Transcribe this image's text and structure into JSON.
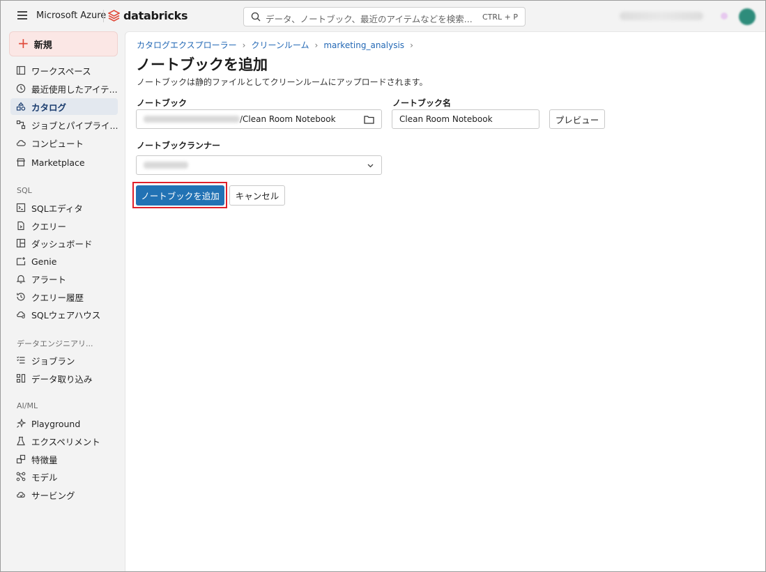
{
  "topbar": {
    "brand_ms": "Microsoft Azure",
    "brand_db": "databricks",
    "search_placeholder": "データ、ノートブック、最近のアイテムなどを検索...",
    "search_shortcut": "CTRL + P",
    "accent": "#e04a3a"
  },
  "sidebar": {
    "new_label": "新規",
    "items": [
      {
        "label": "ワークスペース",
        "icon": "workspace-icon"
      },
      {
        "label": "最近使用したアイテ...",
        "icon": "clock-icon"
      },
      {
        "label": "カタログ",
        "icon": "catalog-icon",
        "active": true
      },
      {
        "label": "ジョブとパイプライ...",
        "icon": "jobs-icon"
      },
      {
        "label": "コンピュート",
        "icon": "cloud-icon"
      },
      {
        "label": "Marketplace",
        "icon": "store-icon"
      }
    ],
    "sql_section": "SQL",
    "sql_items": [
      {
        "label": "SQLエディタ",
        "icon": "sql-editor-icon"
      },
      {
        "label": "クエリー",
        "icon": "query-icon"
      },
      {
        "label": "ダッシュボード",
        "icon": "dashboard-icon"
      },
      {
        "label": "Genie",
        "icon": "genie-icon"
      },
      {
        "label": "アラート",
        "icon": "bell-icon"
      },
      {
        "label": "クエリー履歴",
        "icon": "history-icon"
      },
      {
        "label": "SQLウェアハウス",
        "icon": "warehouse-icon"
      }
    ],
    "de_section": "データエンジニアリ...",
    "de_items": [
      {
        "label": "ジョブラン",
        "icon": "job-runs-icon"
      },
      {
        "label": "データ取り込み",
        "icon": "ingest-icon"
      }
    ],
    "ml_section": "AI/ML",
    "ml_items": [
      {
        "label": "Playground",
        "icon": "sparkle-icon"
      },
      {
        "label": "エクスペリメント",
        "icon": "flask-icon"
      },
      {
        "label": "特徴量",
        "icon": "features-icon"
      },
      {
        "label": "モデル",
        "icon": "models-icon"
      },
      {
        "label": "サービング",
        "icon": "serving-icon"
      }
    ]
  },
  "main": {
    "breadcrumb": [
      "カタログエクスプローラー",
      "クリーンルーム",
      "marketing_analysis"
    ],
    "title": "ノートブックを追加",
    "description": "ノートブックは静的ファイルとしてクリーンルームにアップロードされます。",
    "notebook_label": "ノートブック",
    "notebook_path_suffix": "/Clean Room Notebook",
    "notebook_name_label": "ノートブック名",
    "notebook_name_value": "Clean Room Notebook",
    "preview_label": "プレビュー",
    "runner_label": "ノートブックランナー",
    "add_button": "ノートブックを追加",
    "cancel_button": "キャンセル",
    "primary_color": "#2272b4",
    "highlight_color": "#e0202a"
  }
}
